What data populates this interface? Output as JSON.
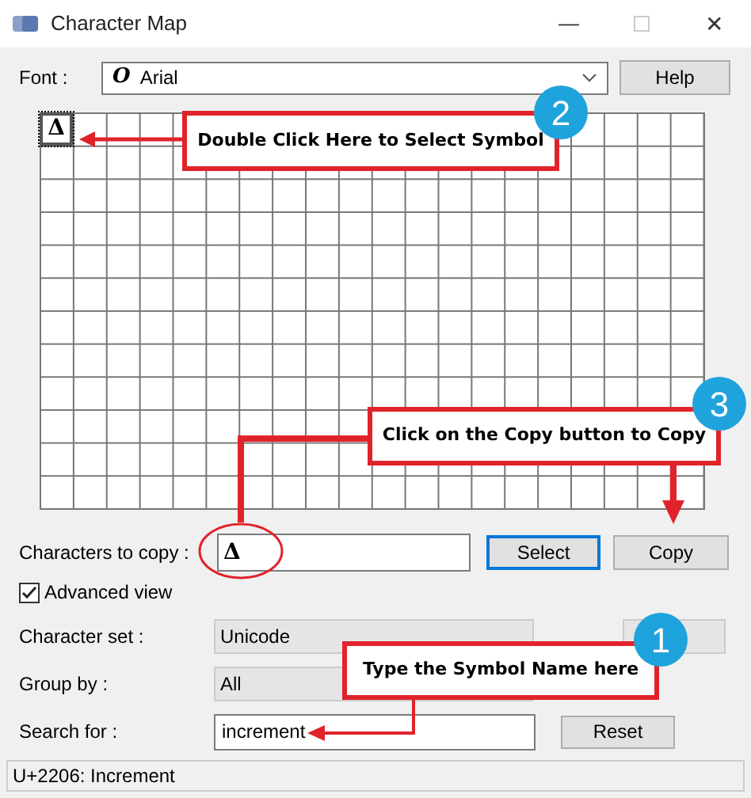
{
  "window": {
    "title": "Character Map",
    "minimize": "—",
    "close": "✕"
  },
  "font": {
    "label": "Font :",
    "icon": "O",
    "value": "Arial"
  },
  "help_button": "Help",
  "grid": {
    "cells": [
      {
        "char": "Δ",
        "selected": true
      }
    ]
  },
  "copy_row": {
    "label": "Characters to copy :",
    "value": "Δ",
    "select_button": "Select",
    "copy_button": "Copy"
  },
  "advanced_view": {
    "label": "Advanced view",
    "checked": true
  },
  "character_set": {
    "label": "Character set :",
    "value": "Unicode"
  },
  "group_by": {
    "label": "Group by :",
    "value": "All"
  },
  "search": {
    "label": "Search for :",
    "value": "increment",
    "reset_button": "Reset"
  },
  "status_bar": "U+2206: Increment",
  "callouts": [
    {
      "number": "2",
      "text": "Double Click Here to Select Symbol"
    },
    {
      "number": "3",
      "text": "Click on the Copy button to Copy"
    },
    {
      "number": "1",
      "text": "Type the Symbol Name here"
    }
  ]
}
